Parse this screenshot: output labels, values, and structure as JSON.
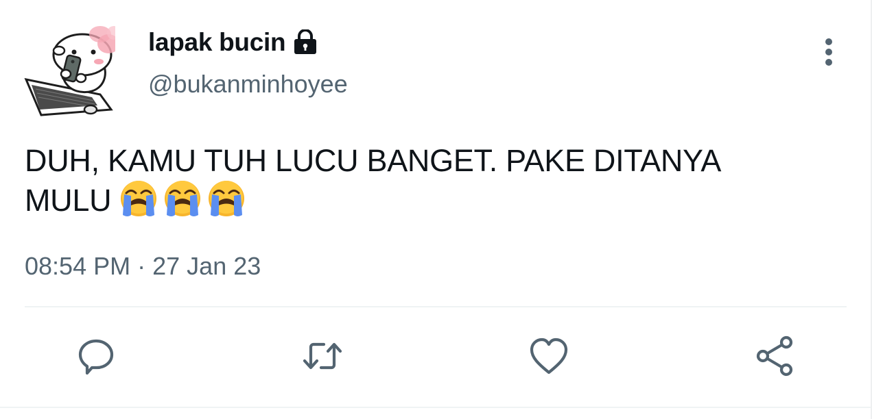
{
  "tweet": {
    "display_name": "lapak bucin",
    "handle": "@bukanminhoyee",
    "text": "DUH, KAMU TUH LUCU BANGET. PAKE DITANYA MULU",
    "emoji_names": [
      "loudly-crying-face",
      "loudly-crying-face",
      "loudly-crying-face"
    ],
    "time": "08:54 PM",
    "separator": "·",
    "date": "27 Jan 23",
    "protected": true
  },
  "icons": {
    "lock": "lock-icon",
    "more": "more-vertical-icon",
    "reply": "reply-icon",
    "retweet": "retweet-icon",
    "like": "heart-icon",
    "share": "share-icon"
  },
  "colors": {
    "text_primary": "#0f1419",
    "text_secondary": "#536471",
    "icon": "#536471",
    "divider": "#eff3f4"
  }
}
